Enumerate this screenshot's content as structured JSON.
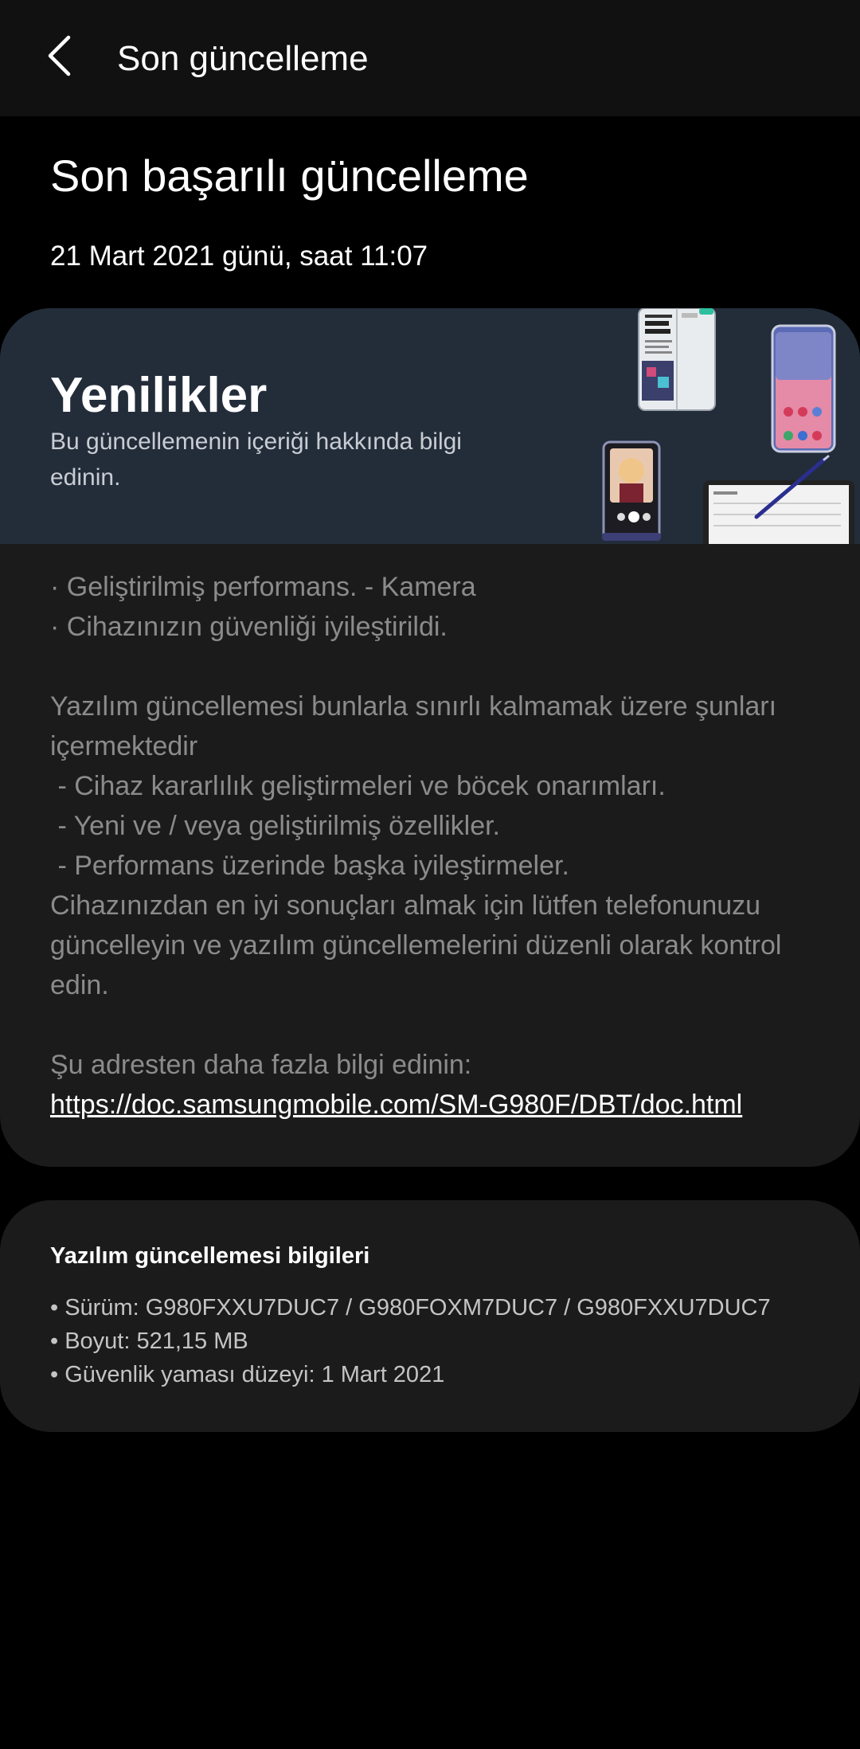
{
  "header": {
    "back_icon": "chevron-left-icon",
    "title": "Son güncelleme"
  },
  "summary": {
    "title": "Son başarılı güncelleme",
    "date": "21 Mart 2021 günü, saat 11:07"
  },
  "whats_new": {
    "heading": "Yenilikler",
    "subheading": "Bu güncellemenin içeriği hakkında bilgi edinin.",
    "banner_image": "galaxy-devices-illustration",
    "banner_color": "#232d3a",
    "items": [
      "· Geliştirilmiş performans. - Kamera",
      "· Cihazınızın güvenliği iyileştirildi.",
      "",
      "Yazılım güncellemesi bunlarla sınırlı kalmamak üzere şunları içermektedir",
      " - Cihaz kararlılık geliştirmeleri ve böcek onarımları.",
      " - Yeni ve / veya geliştirilmiş özellikler.",
      " - Performans üzerinde başka iyileştirmeler.",
      "Cihazınızdan en iyi sonuçları almak için lütfen telefonunuzu güncelleyin ve yazılım güncellemelerini düzenli olarak kontrol edin.",
      "",
      "Şu adresten daha fazla bilgi edinin:"
    ],
    "link": "https://doc.samsungmobile.com/SM-G980F/DBT/doc.html"
  },
  "software_info": {
    "title": "Yazılım güncellemesi bilgileri",
    "version": "• Sürüm: G980FXXU7DUC7 / G980FOXM7DUC7 / G980FXXU7DUC7",
    "size": "• Boyut: 521,15 MB",
    "security_patch": "• Güvenlik yaması düzeyi: 1 Mart 2021"
  },
  "colors": {
    "background": "#000000",
    "app_bar": "#111111",
    "card": "#1b1b1b",
    "body_text": "#8b8b8b"
  }
}
